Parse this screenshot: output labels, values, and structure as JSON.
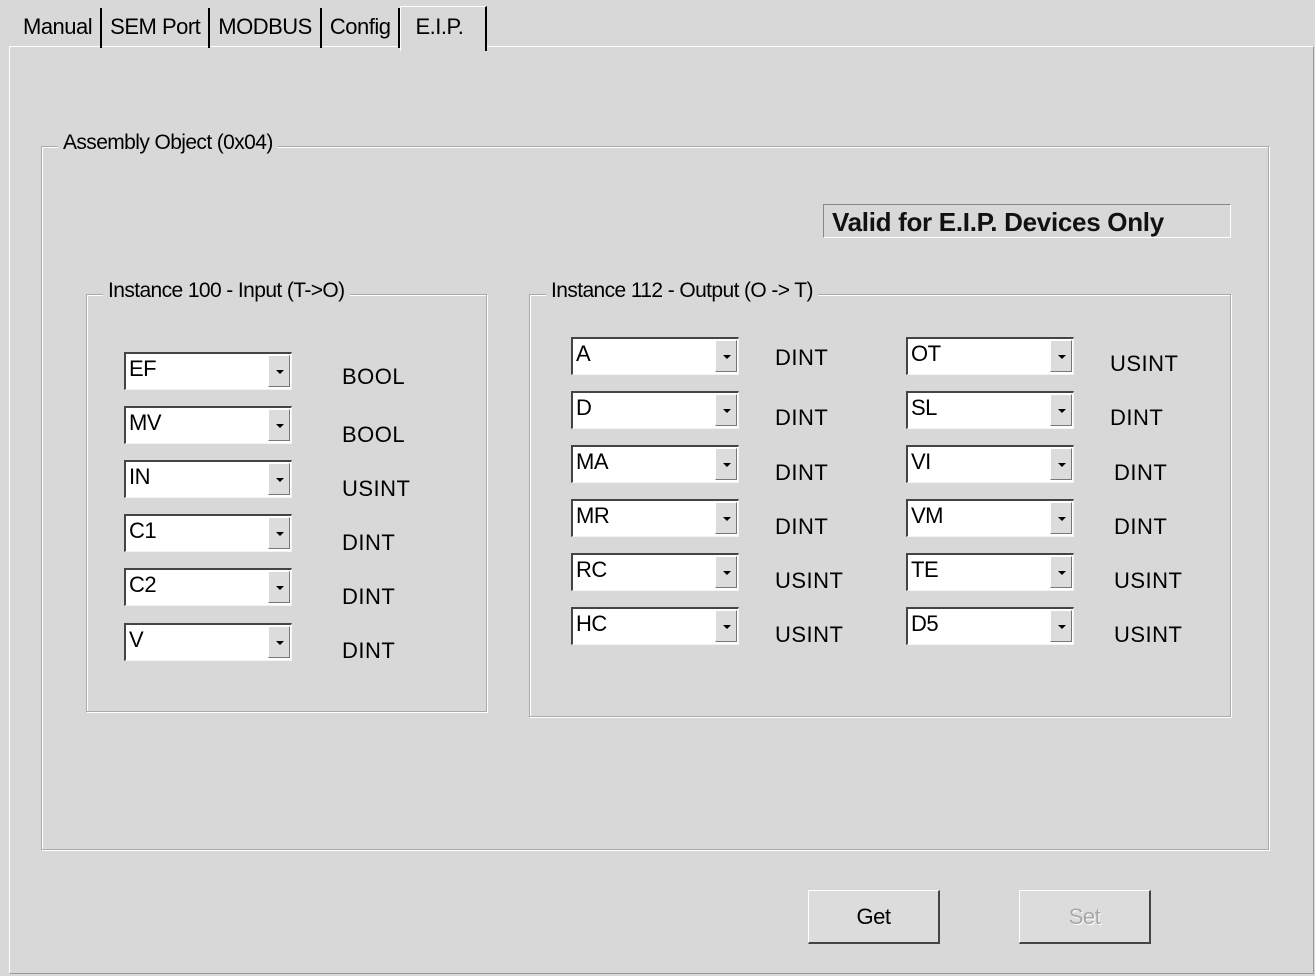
{
  "tabs": [
    "Manual",
    "SEM Port",
    "MODBUS",
    "Config",
    "E.I.P."
  ],
  "assembly": {
    "title": "Assembly Object (0x04)",
    "valid_note": "Valid for E.I.P. Devices Only"
  },
  "input": {
    "title": "Instance 100 - Input (T->O)",
    "rows": [
      {
        "value": "EF",
        "type": "BOOL"
      },
      {
        "value": "MV",
        "type": "BOOL"
      },
      {
        "value": "IN",
        "type": "USINT"
      },
      {
        "value": "C1",
        "type": "DINT"
      },
      {
        "value": "C2",
        "type": "DINT"
      },
      {
        "value": "V",
        "type": "DINT"
      }
    ]
  },
  "output": {
    "title": "Instance 112 - Output (O -> T)",
    "left_rows": [
      {
        "value": "A",
        "type": "DINT"
      },
      {
        "value": "D",
        "type": "DINT"
      },
      {
        "value": "MA",
        "type": "DINT"
      },
      {
        "value": "MR",
        "type": "DINT"
      },
      {
        "value": "RC",
        "type": "USINT"
      },
      {
        "value": "HC",
        "type": "USINT"
      }
    ],
    "right_rows": [
      {
        "value": "OT",
        "type": "USINT"
      },
      {
        "value": "SL",
        "type": "DINT"
      },
      {
        "value": "VI",
        "type": "DINT"
      },
      {
        "value": "VM",
        "type": "DINT"
      },
      {
        "value": "TE",
        "type": "USINT"
      },
      {
        "value": "D5",
        "type": "USINT"
      }
    ]
  },
  "buttons": {
    "get": "Get",
    "set": "Set"
  },
  "icons": {
    "dropdown": "chevron-down-icon"
  }
}
